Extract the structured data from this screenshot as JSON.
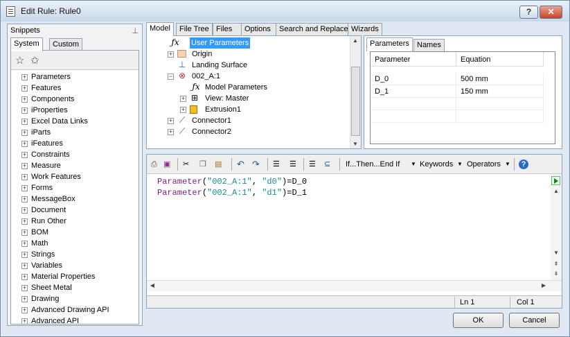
{
  "window": {
    "title": "Edit Rule: Rule0",
    "help_label": "?",
    "close_label": "✕"
  },
  "snippets": {
    "header": "Snippets",
    "tabs": [
      "System",
      "Custom"
    ],
    "items": [
      "Parameters",
      "Features",
      "Components",
      "iProperties",
      "Excel Data Links",
      "iParts",
      "iFeatures",
      "Constraints",
      "Measure",
      "Work Features",
      "Forms",
      "MessageBox",
      "Document",
      "Run Other",
      "BOM",
      "Math",
      "Strings",
      "Variables",
      "Material Properties",
      "Sheet Metal",
      "Drawing",
      "Advanced Drawing API",
      "Advanced API"
    ]
  },
  "top_tabs": [
    "Model",
    "File Tree",
    "Files",
    "Options",
    "Search and Replace",
    "Wizards"
  ],
  "model_tree": [
    {
      "label": "User Parameters",
      "icon": "fx-icon",
      "selected": true
    },
    {
      "label": "Origin",
      "icon": "folder-icon"
    },
    {
      "label": "Landing Surface",
      "icon": "axis-icon"
    },
    {
      "label": "002_A:1",
      "icon": "assembly-icon"
    },
    {
      "label": "Model Parameters",
      "icon": "fx-icon"
    },
    {
      "label": "View: Master",
      "icon": "view-icon"
    },
    {
      "label": "Extrusion1",
      "icon": "extrusion-icon"
    },
    {
      "label": "Connector1",
      "icon": "connector-icon"
    },
    {
      "label": "Connector2",
      "icon": "connector-icon"
    }
  ],
  "param_tabs": [
    "Parameters",
    "Names"
  ],
  "params": {
    "headers": [
      "Parameter",
      "Equation"
    ],
    "rows": [
      [
        "D_0",
        "500 mm"
      ],
      [
        "D_1",
        "150 mm"
      ]
    ]
  },
  "editor_toolbar": {
    "if_then": "If...Then...End If",
    "keywords": "Keywords",
    "operators": "Operators"
  },
  "code": [
    {
      "func": "Parameter",
      "open": "(",
      "arg1": "\"002_A:1\"",
      "comma": ", ",
      "arg2": "\"d0\"",
      "close": ")=D_0"
    },
    {
      "func": "Parameter",
      "open": "(",
      "arg1": "\"002_A:1\"",
      "comma": ", ",
      "arg2": "\"d1\"",
      "close": ")=D_1"
    }
  ],
  "status": {
    "ln": "Ln 1",
    "col": "Col 1"
  },
  "buttons": {
    "ok": "OK",
    "cancel": "Cancel"
  }
}
